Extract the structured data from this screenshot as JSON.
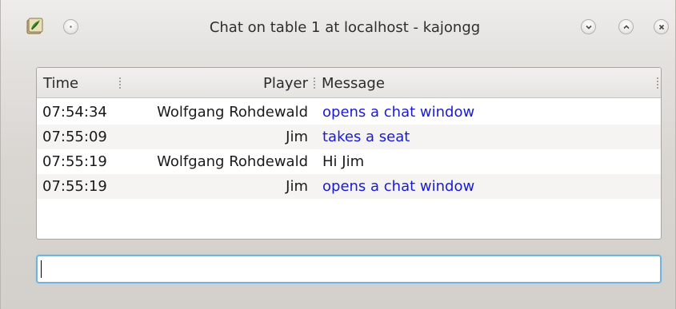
{
  "window": {
    "title": "Chat on table 1 at localhost - kajongg",
    "app_icon": "kajongg-app-icon",
    "buttons": [
      "menu-button",
      "minimize-button",
      "maximize-button",
      "close-button"
    ]
  },
  "table": {
    "columns": [
      "Time",
      "Player",
      "Message"
    ],
    "rows": [
      {
        "time": "07:54:34",
        "player": "Wolfgang Rohdewald",
        "message": "opens a chat window",
        "system": true
      },
      {
        "time": "07:55:09",
        "player": "Jim",
        "message": "takes a seat",
        "system": true
      },
      {
        "time": "07:55:19",
        "player": "Wolfgang Rohdewald",
        "message": "Hi Jim",
        "system": false
      },
      {
        "time": "07:55:19",
        "player": "Jim",
        "message": "opens a chat window",
        "system": true
      }
    ]
  },
  "input": {
    "value": "",
    "placeholder": ""
  },
  "colors": {
    "system_message": "#1a1ad6",
    "input_focus_border": "#71b3de",
    "alt_row": "#f5f4f2"
  }
}
